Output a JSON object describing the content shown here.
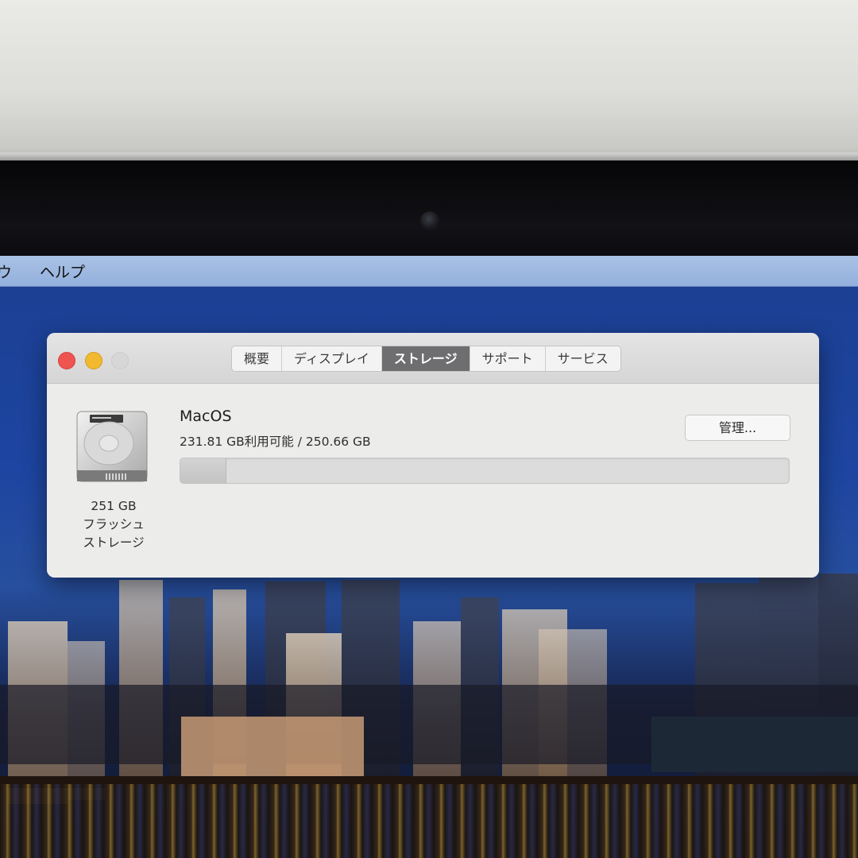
{
  "menubar": {
    "items": [
      {
        "label": "ウ"
      },
      {
        "label": "ヘルプ"
      }
    ]
  },
  "window": {
    "tabs": [
      {
        "label": "概要",
        "active": false
      },
      {
        "label": "ディスプレイ",
        "active": false
      },
      {
        "label": "ストレージ",
        "active": true
      },
      {
        "label": "サポート",
        "active": false
      },
      {
        "label": "サービス",
        "active": false
      }
    ],
    "disk": {
      "icon": "hard-drive-icon",
      "caption_lines": [
        "251 GB",
        "フラッシュ",
        "ストレージ"
      ]
    },
    "volume": {
      "name": "MacOS",
      "info": "231.81 GB利用可能 / 250.66 GB",
      "used_fraction": 0.075
    },
    "manage_button": "管理..."
  },
  "colors": {
    "close": "#ee5450",
    "minimize": "#f0b92f",
    "active_tab": "#6e6e70",
    "menubar": "#a9c1e4"
  }
}
